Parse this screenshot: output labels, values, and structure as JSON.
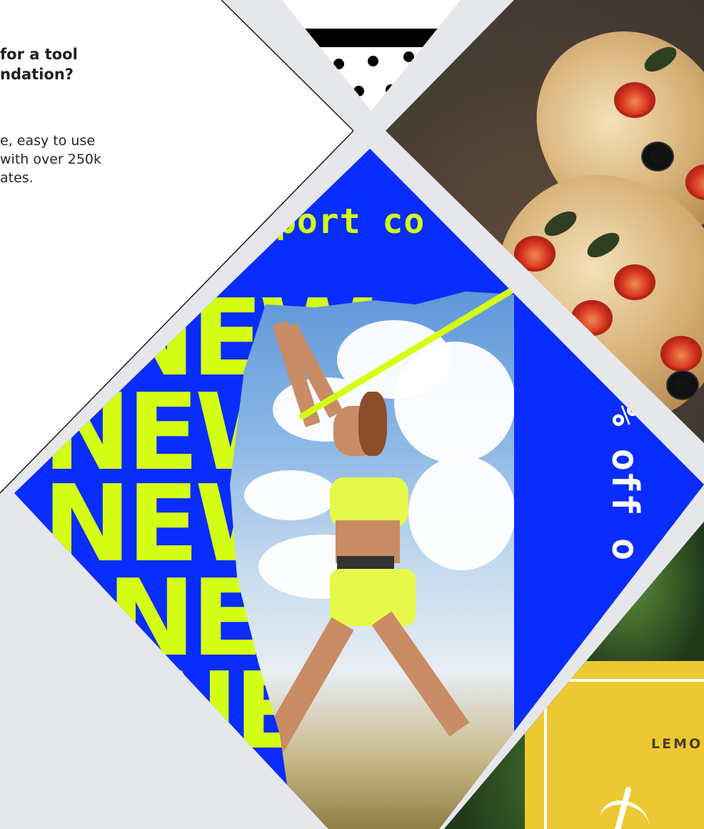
{
  "intro": {
    "headline": "for a tool ndation?",
    "headline_line1": "for a tool",
    "headline_line2": "ndation?",
    "body_line1": "e, easy to use",
    "body_line2": "with over 250k",
    "body_line3": "ates."
  },
  "sport_template": {
    "header_text": "port co",
    "repeated_word": "NEW",
    "side_text": "% off o",
    "accent_color": "#d4ff14",
    "background_color": "#0a2dff"
  },
  "lemon_template": {
    "label": "LEMO",
    "background_color": "#ecc933"
  },
  "pizza_template": {
    "subject": "pizza-photo"
  },
  "colors": {
    "page_background": "#e6e7eb",
    "panel_white": "#ffffff"
  }
}
